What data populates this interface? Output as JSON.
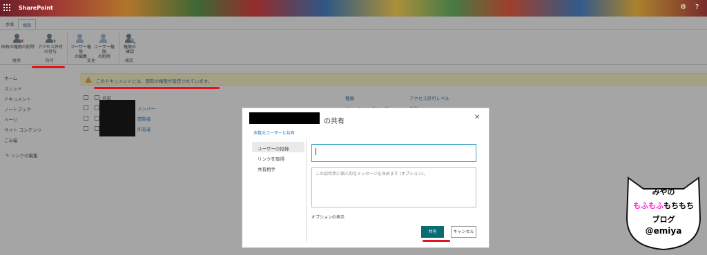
{
  "app": {
    "title": "SharePoint"
  },
  "ribbon": {
    "tabs": [
      "参照",
      "権限"
    ],
    "buttons": [
      {
        "label1": "固有の権限の削除",
        "label2": ""
      },
      {
        "label1": "アクセス許可",
        "label2": "の付与"
      },
      {
        "label1": "ユーザー権限",
        "label2": "の編集"
      },
      {
        "label1": "ユーザー権限",
        "label2": "の削除"
      },
      {
        "label1": "権限の",
        "label2": "確認"
      }
    ],
    "groups": [
      "継承",
      "許可",
      "変更",
      "確認"
    ]
  },
  "leftnav": {
    "items": [
      "ホーム",
      "スレッド",
      "ドキュメント",
      "ノートブック",
      "ページ",
      "サイト コンテンツ",
      "ごみ箱"
    ],
    "edit_links": "リンクの編集"
  },
  "warning": {
    "text": "このドキュメントには、固有の権限が設定されています。"
  },
  "list": {
    "headers": {
      "name": "名前",
      "type": "種類",
      "permission": "アクセス許可レベル"
    },
    "rows": [
      {
        "name": "メンバー",
        "type": "SharePoint グループ",
        "permission": "編集"
      },
      {
        "name": "閲覧者",
        "type": "",
        "permission": ""
      },
      {
        "name": "所有者",
        "type": "",
        "permission": ""
      }
    ]
  },
  "dialog": {
    "title": "の共有",
    "subtitle": "多数のユーザーと共有",
    "nav": [
      "ユーザーの招待",
      "リンクを取得",
      "共有相手"
    ],
    "message_placeholder": "この招待状に個人的なメッセージを含めます (オプション)。",
    "options_link": "オプションの表示",
    "share_button": "共有",
    "cancel_button": "キャンセル",
    "close_icon": "close-icon"
  },
  "watermark": {
    "line1": "みやの",
    "line2a": "もふもふ",
    "line2b": "もちもち",
    "line3": "ブログ",
    "line4": "@emiya",
    "colors": {
      "magenta": "#ff2bd6",
      "black": "#000000"
    }
  },
  "colors": {
    "teal": "#0a6b73",
    "link": "#1f6fb8",
    "warning_bg": "#fff6c8",
    "annotation": "#e0141b"
  }
}
